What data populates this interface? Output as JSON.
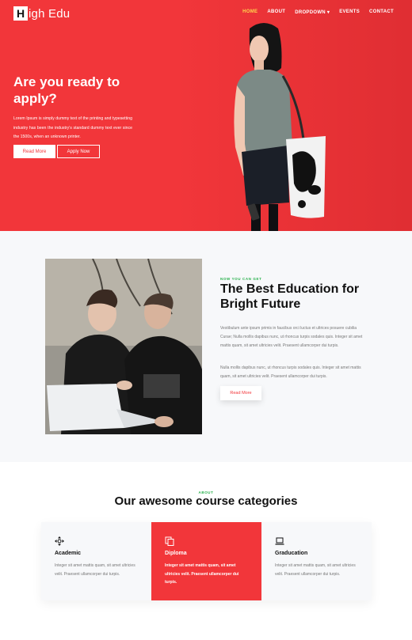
{
  "brand": {
    "logo_letter": "H",
    "logo_text": "igh Edu"
  },
  "nav": [
    {
      "label": "HOME",
      "active": true
    },
    {
      "label": "ABOUT"
    },
    {
      "label": "DROPDOWN ▾"
    },
    {
      "label": "EVENTS"
    },
    {
      "label": "CONTACT"
    }
  ],
  "hero": {
    "title": "Are you ready to apply?",
    "description": "Lorem Ipsum is simply dummy text of the printing and typesetting industry has been the industry's standard dummy text ever since the 1500s, when an unknown printer.",
    "btn_read_more": "Read More",
    "btn_apply": "Apply Now"
  },
  "about": {
    "eyebrow": "NOW YOU CAN GET",
    "title": "The Best Education for Bright Future",
    "p1": "Vestibulum ante ipsum primis in faucibus orci luctus et ultrices posuere cubilia Curae; Nulla mollis dapibus nunc, ut rhoncus turpis sodales quis. Integer sit amet mattis quam, sit amet ultricies velit. Praesent ullamcorper dui turpis.",
    "p2": "Nulla mollis dapibus nunc, ut rhoncus turpis sodales quis. Integer sit amet mattis quam, sit amet ultricies velit. Praesent ullamcorper dui turpis.",
    "btn": "Read More"
  },
  "courses": {
    "eyebrow": "ABOUT",
    "title": "Our awesome course categories",
    "cards": [
      {
        "icon": "move-icon",
        "title": "Academic",
        "text": "Integer sit amet mattis quam, sit amet ultricies velit. Praesent ullamcorper dui turpis."
      },
      {
        "icon": "copy-icon",
        "title": "Diploma",
        "text": "Integer sit amet mattis quam, sit amet ultricies velit. Praesent ullamcorper dui turpis."
      },
      {
        "icon": "laptop-icon",
        "title": "Graducation",
        "text": "Integer sit amet mattis quam, sit amet ultricies velit. Praesent ullamcorper dui turpis."
      }
    ]
  },
  "colors": {
    "accent": "#f2363a",
    "green": "#26b04a",
    "nav_active": "#ffd54d"
  }
}
